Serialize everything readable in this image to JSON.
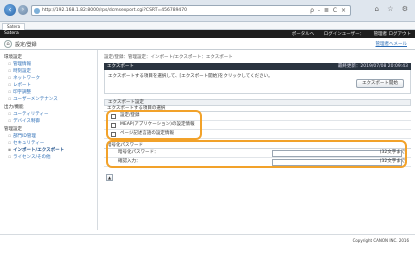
{
  "browser": {
    "back_icon": "back-arrow-icon",
    "forward_icon": "forward-arrow-icon",
    "url": "http://192.168.1.82:8000/rps/dcmsexport.cgi?CSRT=456789470",
    "addr_controls": "ρ - ≣ C ×",
    "window_icons": "⌂ ☆ ⚙"
  },
  "tab": {
    "label": "Satera"
  },
  "app_header": {
    "brand": "Satera",
    "portal_link": "ポータルへ",
    "login_user": "ログインユーザー：",
    "logout": "管理者 ログアウト"
  },
  "title_row": {
    "home_icon": "home-icon",
    "title": "設定/登録",
    "mail_link": "管理者へメール"
  },
  "sidebar": {
    "pref_header": "環境設定",
    "pref_items": [
      {
        "label": "管理情報"
      },
      {
        "label": "時刻設定"
      },
      {
        "label": "ネットワーク"
      },
      {
        "label": "レポート"
      },
      {
        "label": "印字調整"
      },
      {
        "label": "ユーザーメンテナンス"
      }
    ],
    "output_header": "出力/機能",
    "output_items": [
      {
        "label": "ユーティリティー"
      },
      {
        "label": "デバイス制御"
      }
    ],
    "mgmt_header": "管理設定",
    "mgmt_items": [
      {
        "label": "部門ID管理"
      },
      {
        "label": "セキュリティー"
      },
      {
        "label": "インポート/エクスポート"
      },
      {
        "label": "ライセンス/その他"
      }
    ]
  },
  "main": {
    "breadcrumb": "設定/登録：管理設定：インポート/エクスポート：エクスポート",
    "panel_title": "エクスポート",
    "panel_time": "最終更新：2019/07/08 20:09:43",
    "panel_desc": "エクスポートする項目を選択して、[エクスポート開始]をクリックしてください。",
    "export_button": "エクスポート開始",
    "settings_header": "エクスポート設定",
    "items_header": "エクスポートする項目の選択",
    "items": [
      {
        "label": "設定/登録"
      },
      {
        "label": "MEAP(アプリケーション)の設定情報"
      },
      {
        "label": "ページ記述言語の設定情報"
      }
    ],
    "password_header": "暗号化パスワード",
    "password_rows": [
      {
        "label": "暗号化パスワード：",
        "note": "(32文字まで)"
      },
      {
        "label": "確認入力：",
        "note": "(32文字まで)"
      }
    ]
  },
  "footer": {
    "copyright": "Copyright CANON INC. 2016"
  },
  "colors": {
    "highlight": "#f2a22a",
    "header_bar": "#1e1e1e",
    "panel_header": "#2a3440",
    "link": "#2a6cb5"
  }
}
